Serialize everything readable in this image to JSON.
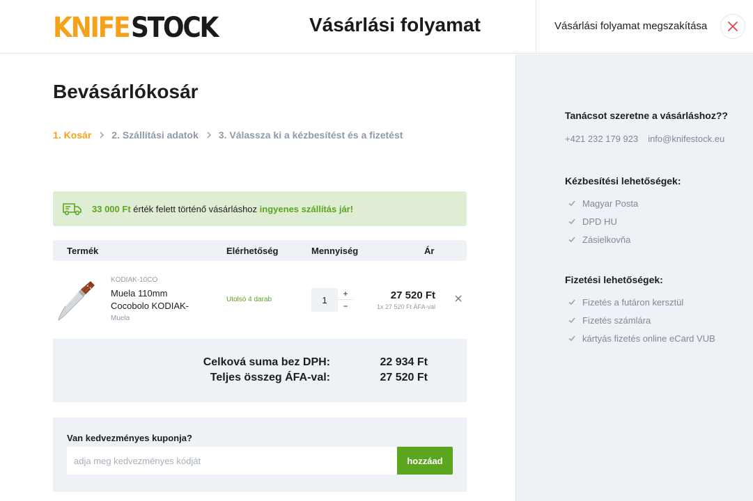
{
  "header": {
    "logo_part1": "KNIFE",
    "logo_part2": "STOCK",
    "title": "Vásárlási folyamat",
    "cancel_label": "Vásárlási folyamat megszakítása",
    "close_icon": "close-icon"
  },
  "main": {
    "title": "Bevásárlókosár",
    "steps": [
      {
        "number": "1.",
        "label": "Kosár",
        "active": true
      },
      {
        "number": "2.",
        "label": "Szállítási adatok",
        "active": false
      },
      {
        "number": "3.",
        "label": "Válassza ki a kézbesítést és a fizetést",
        "active": false
      }
    ],
    "free_shipping": {
      "amount": "33 000 Ft",
      "text": "érték felett történő vásárláshoz",
      "highlight": "ingyenes szállítás jár!"
    },
    "table": {
      "headers": [
        "Termék",
        "Elérhetőség",
        "Mennyiség",
        "Ár"
      ],
      "item": {
        "code": "KODIAK-10CO",
        "name": "Muela 110mm Cocobolo KODIAK-",
        "brand": "Muela",
        "availability": "Utolsó 4 darab",
        "quantity": "1",
        "plus": "+",
        "minus": "−",
        "price": "27 520 Ft",
        "price_detail": "1x 27 520 Ft ÁFA-val"
      }
    },
    "totals": {
      "net_label": "Celková suma bez DPH:",
      "net_value": "22 934 Ft",
      "gross_label": "Teljes összeg ÁFA-val:",
      "gross_value": "27 520 Ft"
    },
    "coupon": {
      "label": "Van kedvezményes kuponja?",
      "placeholder": "adja meg kedvezményes kódját",
      "button": "hozzáad"
    }
  },
  "sidebar": {
    "help_title": "Tanácsot szeretne a vásárláshoz??",
    "phone": "+421 232 179 923",
    "email": "info@knifestock.eu",
    "delivery_title": "Kézbesítési lehetőségek:",
    "delivery": [
      "Magyar Posta",
      "DPD HU",
      "Zásielkovňa"
    ],
    "payment_title": "Fizetési lehetőségek:",
    "payment": [
      "Fizetés a futáron kersztül",
      "Fizetés számlára",
      "kártyás fizetés online eCard VUB"
    ]
  },
  "colors": {
    "accent": "#f5a21a",
    "green": "#5ca51e",
    "panel": "#eef1f5",
    "banner": "#deedd4"
  }
}
